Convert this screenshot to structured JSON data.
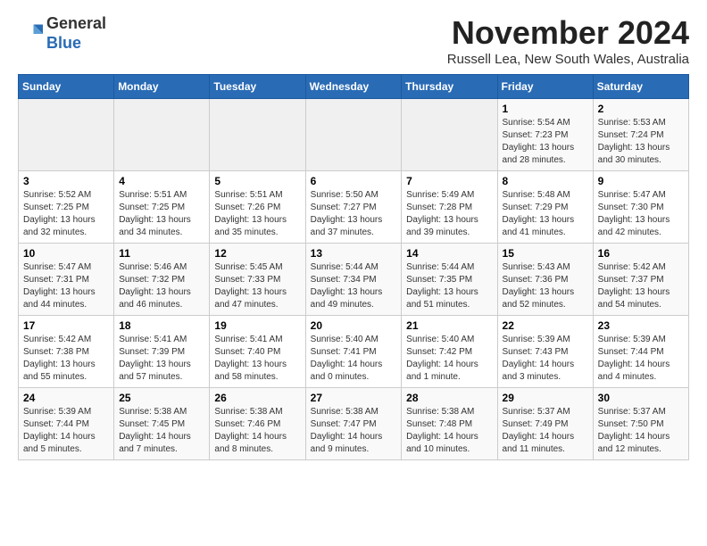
{
  "logo": {
    "general": "General",
    "blue": "Blue"
  },
  "header": {
    "month": "November 2024",
    "location": "Russell Lea, New South Wales, Australia"
  },
  "weekdays": [
    "Sunday",
    "Monday",
    "Tuesday",
    "Wednesday",
    "Thursday",
    "Friday",
    "Saturday"
  ],
  "weeks": [
    [
      {
        "day": "",
        "info": ""
      },
      {
        "day": "",
        "info": ""
      },
      {
        "day": "",
        "info": ""
      },
      {
        "day": "",
        "info": ""
      },
      {
        "day": "",
        "info": ""
      },
      {
        "day": "1",
        "info": "Sunrise: 5:54 AM\nSunset: 7:23 PM\nDaylight: 13 hours and 28 minutes."
      },
      {
        "day": "2",
        "info": "Sunrise: 5:53 AM\nSunset: 7:24 PM\nDaylight: 13 hours and 30 minutes."
      }
    ],
    [
      {
        "day": "3",
        "info": "Sunrise: 5:52 AM\nSunset: 7:25 PM\nDaylight: 13 hours and 32 minutes."
      },
      {
        "day": "4",
        "info": "Sunrise: 5:51 AM\nSunset: 7:25 PM\nDaylight: 13 hours and 34 minutes."
      },
      {
        "day": "5",
        "info": "Sunrise: 5:51 AM\nSunset: 7:26 PM\nDaylight: 13 hours and 35 minutes."
      },
      {
        "day": "6",
        "info": "Sunrise: 5:50 AM\nSunset: 7:27 PM\nDaylight: 13 hours and 37 minutes."
      },
      {
        "day": "7",
        "info": "Sunrise: 5:49 AM\nSunset: 7:28 PM\nDaylight: 13 hours and 39 minutes."
      },
      {
        "day": "8",
        "info": "Sunrise: 5:48 AM\nSunset: 7:29 PM\nDaylight: 13 hours and 41 minutes."
      },
      {
        "day": "9",
        "info": "Sunrise: 5:47 AM\nSunset: 7:30 PM\nDaylight: 13 hours and 42 minutes."
      }
    ],
    [
      {
        "day": "10",
        "info": "Sunrise: 5:47 AM\nSunset: 7:31 PM\nDaylight: 13 hours and 44 minutes."
      },
      {
        "day": "11",
        "info": "Sunrise: 5:46 AM\nSunset: 7:32 PM\nDaylight: 13 hours and 46 minutes."
      },
      {
        "day": "12",
        "info": "Sunrise: 5:45 AM\nSunset: 7:33 PM\nDaylight: 13 hours and 47 minutes."
      },
      {
        "day": "13",
        "info": "Sunrise: 5:44 AM\nSunset: 7:34 PM\nDaylight: 13 hours and 49 minutes."
      },
      {
        "day": "14",
        "info": "Sunrise: 5:44 AM\nSunset: 7:35 PM\nDaylight: 13 hours and 51 minutes."
      },
      {
        "day": "15",
        "info": "Sunrise: 5:43 AM\nSunset: 7:36 PM\nDaylight: 13 hours and 52 minutes."
      },
      {
        "day": "16",
        "info": "Sunrise: 5:42 AM\nSunset: 7:37 PM\nDaylight: 13 hours and 54 minutes."
      }
    ],
    [
      {
        "day": "17",
        "info": "Sunrise: 5:42 AM\nSunset: 7:38 PM\nDaylight: 13 hours and 55 minutes."
      },
      {
        "day": "18",
        "info": "Sunrise: 5:41 AM\nSunset: 7:39 PM\nDaylight: 13 hours and 57 minutes."
      },
      {
        "day": "19",
        "info": "Sunrise: 5:41 AM\nSunset: 7:40 PM\nDaylight: 13 hours and 58 minutes."
      },
      {
        "day": "20",
        "info": "Sunrise: 5:40 AM\nSunset: 7:41 PM\nDaylight: 14 hours and 0 minutes."
      },
      {
        "day": "21",
        "info": "Sunrise: 5:40 AM\nSunset: 7:42 PM\nDaylight: 14 hours and 1 minute."
      },
      {
        "day": "22",
        "info": "Sunrise: 5:39 AM\nSunset: 7:43 PM\nDaylight: 14 hours and 3 minutes."
      },
      {
        "day": "23",
        "info": "Sunrise: 5:39 AM\nSunset: 7:44 PM\nDaylight: 14 hours and 4 minutes."
      }
    ],
    [
      {
        "day": "24",
        "info": "Sunrise: 5:39 AM\nSunset: 7:44 PM\nDaylight: 14 hours and 5 minutes."
      },
      {
        "day": "25",
        "info": "Sunrise: 5:38 AM\nSunset: 7:45 PM\nDaylight: 14 hours and 7 minutes."
      },
      {
        "day": "26",
        "info": "Sunrise: 5:38 AM\nSunset: 7:46 PM\nDaylight: 14 hours and 8 minutes."
      },
      {
        "day": "27",
        "info": "Sunrise: 5:38 AM\nSunset: 7:47 PM\nDaylight: 14 hours and 9 minutes."
      },
      {
        "day": "28",
        "info": "Sunrise: 5:38 AM\nSunset: 7:48 PM\nDaylight: 14 hours and 10 minutes."
      },
      {
        "day": "29",
        "info": "Sunrise: 5:37 AM\nSunset: 7:49 PM\nDaylight: 14 hours and 11 minutes."
      },
      {
        "day": "30",
        "info": "Sunrise: 5:37 AM\nSunset: 7:50 PM\nDaylight: 14 hours and 12 minutes."
      }
    ]
  ]
}
